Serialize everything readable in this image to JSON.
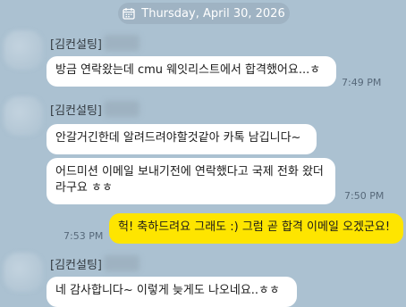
{
  "date_label": "Thursday, April 30, 2026",
  "colors": {
    "background": "#abc1d1",
    "incoming_bubble": "#ffffff",
    "outgoing_bubble": "#fee500",
    "date_pill": "#9fb3c3"
  },
  "messages": [
    {
      "sender": "[김컨설팅]",
      "text": [
        "방금 연락왔는데 cmu 웨잇리스트에서 합격했어요...ㅎ"
      ],
      "time": "7:49 PM"
    },
    {
      "sender": "[김컨설팅]",
      "text": [
        "안갈거긴한데 알려드려야할것같아 카톡 남깁니다~"
      ],
      "time": ""
    },
    {
      "sender": "",
      "text": [
        "어드미션 이메일 보내기전에 연락했다고 국제 전화 왔더",
        "라구요 ㅎㅎ"
      ],
      "time": "7:50 PM"
    },
    {
      "sender": "me",
      "text": [
        "헉! 축하드려요 그래도 :) 그럼 곧 합격 이메일 오겠군요!"
      ],
      "time": "7:53 PM"
    },
    {
      "sender": "[김컨설팅]",
      "text": [
        "네 감사합니다~ 이렇게 늦게도 나오네요..ㅎㅎ"
      ],
      "time": ""
    }
  ]
}
